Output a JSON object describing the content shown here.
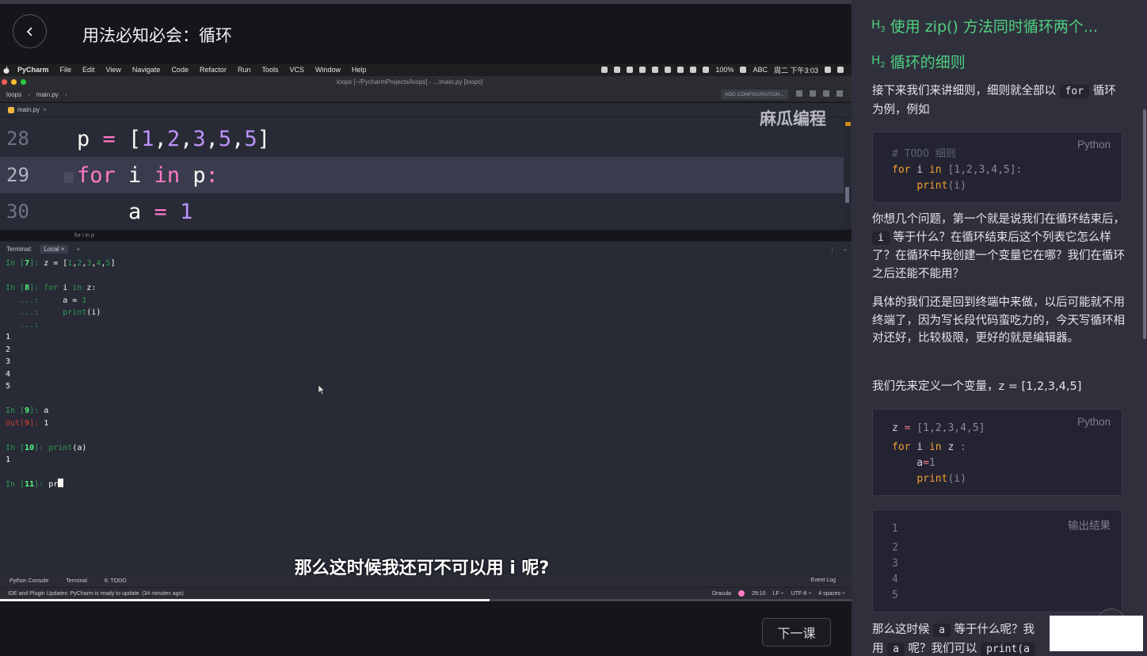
{
  "player": {
    "lesson_title": "用法必知必会：循环",
    "next_button": "下一课",
    "progress": 0.575,
    "subtitle": "那么这时候我还可不可以用 i 呢?"
  },
  "macos": {
    "app_name": "PyCharm",
    "menus": [
      "File",
      "Edit",
      "View",
      "Navigate",
      "Code",
      "Refactor",
      "Run",
      "Tools",
      "VCS",
      "Window",
      "Help"
    ],
    "battery": "100%",
    "input_method": "ABC",
    "clock": "周二 下午3:03"
  },
  "ide": {
    "window_title": "loops [~/PycharmProjects/loops] - .../main.py [loops]",
    "nav_project": "loops",
    "nav_file": "main.py",
    "add_config": "ADD CONFIGURATION...",
    "editor_tab": "main.py",
    "watermark": "麻瓜编程",
    "lines": [
      {
        "num": "28"
      },
      {
        "num": "29"
      },
      {
        "num": "30"
      }
    ],
    "breadcrumb_hint": "for i in p",
    "terminal_label": "Terminal:",
    "terminal_tab": "Local",
    "tool_tabs": [
      "Python Console",
      "Terminal",
      "6: TODO"
    ],
    "status_message": "IDE and Plugin Updates: PyCharm is ready to update. (34 minutes ago)",
    "event_log": "Event Log",
    "status_right": [
      "Dracula",
      "29:10",
      "LF ÷",
      "UTF-8 ÷",
      "4 spaces ÷"
    ]
  },
  "notes": {
    "h3": "使用 zip() 方法同时循环两个...",
    "h2": "循环的细则",
    "p1_before": "接下来我们来讲细则，细则就全部以",
    "p1_code": "for",
    "p1_after": "循环为例，例如",
    "code1_lang": "Python",
    "code1_comment": "# TODO 细则",
    "p2_a": "你想几个问题，第一个就是说我们在循环结束后，",
    "p2_code": "i",
    "p2_b": "等于什么？在循环结束后这个列表它怎么样了？在循环中我创建一个变量它在哪？我们在循环之后还能不能用？",
    "p3": "具体的我们还是回到终端中来做，以后可能就不用终端了，因为写长段代码蛮吃力的，今天写循环相对还好，比较极限，更好的就是编辑器。",
    "p4": "我们先来定义一个变量，z = [1,2,3,4,5]",
    "code2_lang": "Python",
    "output_label": "输出结果",
    "output_lines": [
      "1",
      "2",
      "3",
      "4",
      "5"
    ],
    "p5_a": "那么这时候",
    "p5_code_a": "a",
    "p5_b": "等于什么呢？我",
    "p5_c": "用",
    "p5_code_a2": "a",
    "p5_d": "呢？我们可以",
    "p5_code_print": "print(a"
  }
}
